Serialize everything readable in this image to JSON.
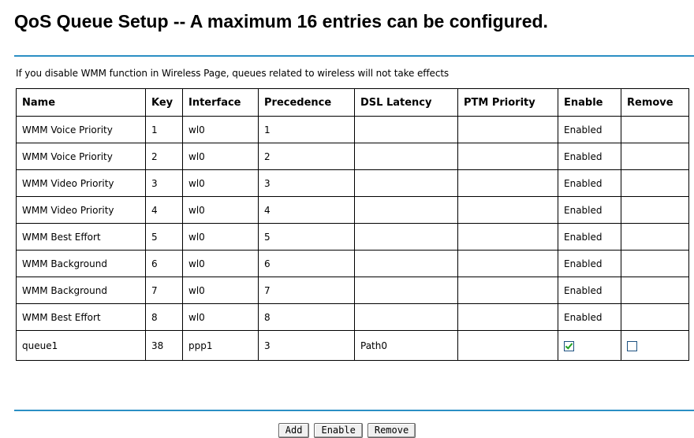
{
  "page": {
    "title": "QoS Queue Setup -- A maximum 16 entries can be configured.",
    "note": "If you disable WMM function in Wireless Page, queues related to wireless will not take effects"
  },
  "table": {
    "headers": [
      "Name",
      "Key",
      "Interface",
      "Precedence",
      "DSL Latency",
      "PTM Priority",
      "Enable",
      "Remove"
    ],
    "rows": [
      {
        "name": "WMM Voice Priority",
        "key": "1",
        "interface": "wl0",
        "precedence": "1",
        "dsl_latency": "",
        "ptm_priority": "",
        "enable": "Enabled"
      },
      {
        "name": "WMM Voice Priority",
        "key": "2",
        "interface": "wl0",
        "precedence": "2",
        "dsl_latency": "",
        "ptm_priority": "",
        "enable": "Enabled"
      },
      {
        "name": "WMM Video Priority",
        "key": "3",
        "interface": "wl0",
        "precedence": "3",
        "dsl_latency": "",
        "ptm_priority": "",
        "enable": "Enabled"
      },
      {
        "name": "WMM Video Priority",
        "key": "4",
        "interface": "wl0",
        "precedence": "4",
        "dsl_latency": "",
        "ptm_priority": "",
        "enable": "Enabled"
      },
      {
        "name": "WMM Best Effort",
        "key": "5",
        "interface": "wl0",
        "precedence": "5",
        "dsl_latency": "",
        "ptm_priority": "",
        "enable": "Enabled"
      },
      {
        "name": "WMM Background",
        "key": "6",
        "interface": "wl0",
        "precedence": "6",
        "dsl_latency": "",
        "ptm_priority": "",
        "enable": "Enabled"
      },
      {
        "name": "WMM Background",
        "key": "7",
        "interface": "wl0",
        "precedence": "7",
        "dsl_latency": "",
        "ptm_priority": "",
        "enable": "Enabled"
      },
      {
        "name": "WMM Best Effort",
        "key": "8",
        "interface": "wl0",
        "precedence": "8",
        "dsl_latency": "",
        "ptm_priority": "",
        "enable": "Enabled"
      },
      {
        "name": "queue1",
        "key": "38",
        "interface": "ppp1",
        "precedence": "3",
        "dsl_latency": "Path0",
        "ptm_priority": "",
        "enable_checked": true,
        "remove_checked": false
      }
    ]
  },
  "buttons": {
    "add": "Add",
    "enable": "Enable",
    "remove": "Remove"
  },
  "colors": {
    "rule": "#2b8fc4",
    "checkmark": "#21a121"
  }
}
